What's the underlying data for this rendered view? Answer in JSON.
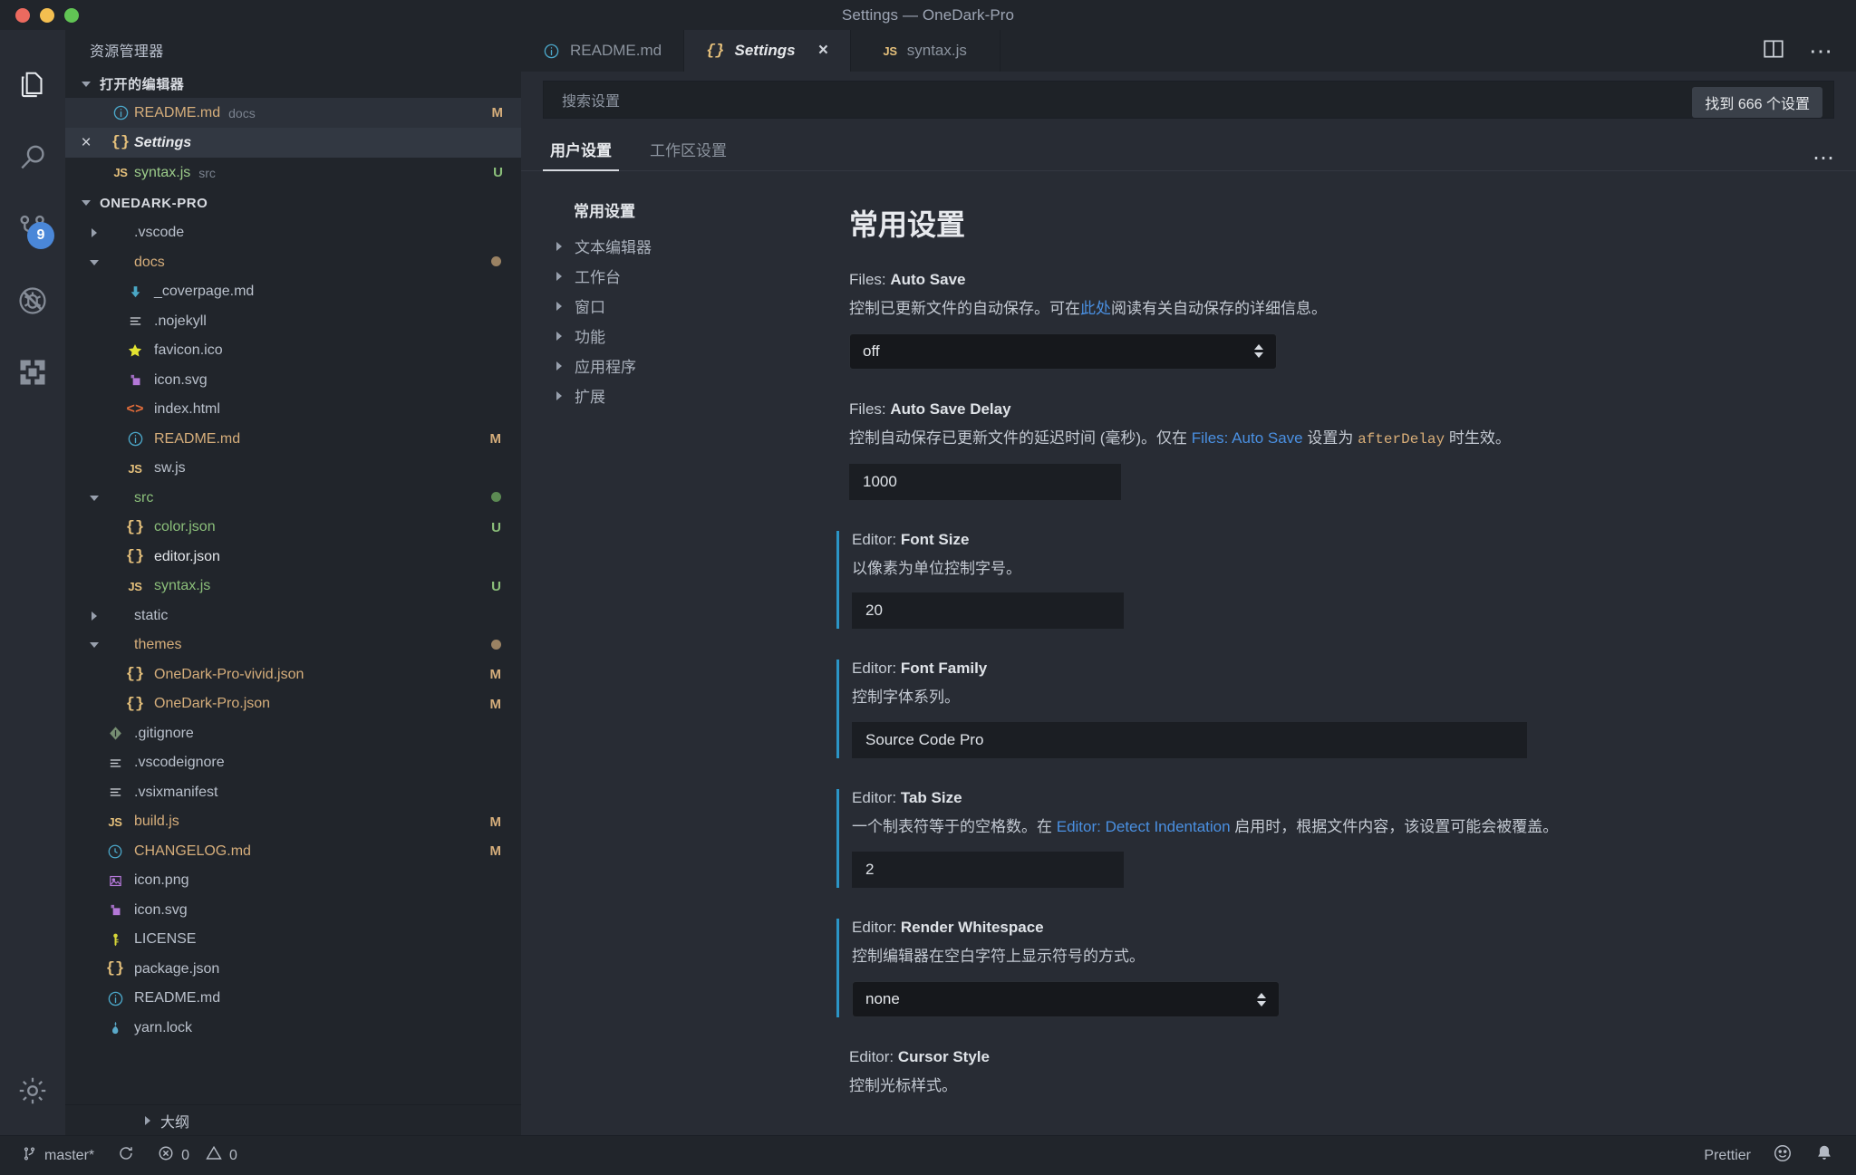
{
  "window": {
    "title": "Settings — OneDark-Pro",
    "traffic_lights": [
      "close",
      "minimize",
      "maximize"
    ]
  },
  "activity_bar": {
    "items": [
      {
        "name": "explorer",
        "icon": "files-icon",
        "badge": null
      },
      {
        "name": "search",
        "icon": "search-icon",
        "badge": null
      },
      {
        "name": "source-control",
        "icon": "source-control-icon",
        "badge": "9"
      },
      {
        "name": "debug",
        "icon": "debug-icon",
        "badge": null
      },
      {
        "name": "extensions",
        "icon": "extensions-icon",
        "badge": null
      }
    ],
    "settings_icon": "gear-icon"
  },
  "sidebar": {
    "title": "资源管理器",
    "open_editors": {
      "header": "打开的编辑器",
      "items": [
        {
          "icon": "info-icon",
          "icon_color": "#4ba7c9",
          "name": "README.md",
          "name_color": "#d6ae7b",
          "sub": "docs",
          "status": "M",
          "status_color": "#d6ae7b",
          "state": "hover"
        },
        {
          "icon": "braces-icon",
          "icon_color": "#e5c07b",
          "name": "Settings",
          "name_color": "#e6e8eb",
          "sub": "",
          "status": "",
          "status_color": "",
          "state": "active",
          "close": "×",
          "italic": true
        },
        {
          "icon": "js-icon",
          "icon_color": "#e5c07b",
          "name": "syntax.js",
          "name_color": "#9ccc8a",
          "sub": "src",
          "status": "U",
          "status_color": "#8bbf7a",
          "state": "normal"
        }
      ]
    },
    "project": {
      "header": "ONEDARK-PRO",
      "rows": [
        {
          "arrow": "closed",
          "indent": 1,
          "icon": "",
          "icon_color": "",
          "name": ".vscode",
          "color": "#b9c0cb",
          "status": "",
          "dot": ""
        },
        {
          "arrow": "open",
          "indent": 1,
          "icon": "",
          "icon_color": "",
          "name": "docs",
          "color": "#d6ae7b",
          "status": "",
          "dot": "#9a8263"
        },
        {
          "arrow": "none",
          "indent": 2,
          "icon": "markdown-down-icon",
          "icon_color": "#4aa8c6",
          "name": "_coverpage.md",
          "color": "#b9c0cb",
          "status": "",
          "dot": ""
        },
        {
          "arrow": "none",
          "indent": 2,
          "icon": "lines-icon",
          "icon_color": "#d7dae0",
          "name": ".nojekyll",
          "color": "#b9c0cb",
          "status": "",
          "dot": ""
        },
        {
          "arrow": "none",
          "indent": 2,
          "icon": "star-icon",
          "icon_color": "#e3e331",
          "name": "favicon.ico",
          "color": "#b9c0cb",
          "status": "",
          "dot": ""
        },
        {
          "arrow": "none",
          "indent": 2,
          "icon": "svg-icon",
          "icon_color": "#b478d8",
          "name": "icon.svg",
          "color": "#b9c0cb",
          "status": "",
          "dot": ""
        },
        {
          "arrow": "none",
          "indent": 2,
          "icon": "html-icon",
          "icon_color": "#e06c3a",
          "name": "index.html",
          "color": "#b9c0cb",
          "status": "",
          "dot": ""
        },
        {
          "arrow": "none",
          "indent": 2,
          "icon": "info-icon",
          "icon_color": "#4ba7c9",
          "name": "README.md",
          "color": "#d6ae7b",
          "status": "M",
          "status_color": "#d6ae7b",
          "dot": ""
        },
        {
          "arrow": "none",
          "indent": 2,
          "icon": "js-icon",
          "icon_color": "#e5c07b",
          "name": "sw.js",
          "color": "#b9c0cb",
          "status": "",
          "dot": ""
        },
        {
          "arrow": "open",
          "indent": 1,
          "icon": "",
          "icon_color": "",
          "name": "src",
          "color": "#8bbf7a",
          "status": "",
          "dot": "#5c8a53"
        },
        {
          "arrow": "none",
          "indent": 2,
          "icon": "braces-icon",
          "icon_color": "#e5c07b",
          "name": "color.json",
          "color": "#8bbf7a",
          "status": "U",
          "status_color": "#8bbf7a",
          "dot": ""
        },
        {
          "arrow": "none",
          "indent": 2,
          "icon": "braces-icon",
          "icon_color": "#e5c07b",
          "name": "editor.json",
          "color": "#e3e6ea",
          "status": "",
          "dot": ""
        },
        {
          "arrow": "none",
          "indent": 2,
          "icon": "js-icon",
          "icon_color": "#e5c07b",
          "name": "syntax.js",
          "color": "#8bbf7a",
          "status": "U",
          "status_color": "#8bbf7a",
          "dot": ""
        },
        {
          "arrow": "closed",
          "indent": 1,
          "icon": "",
          "icon_color": "",
          "name": "static",
          "color": "#b9c0cb",
          "status": "",
          "dot": ""
        },
        {
          "arrow": "open",
          "indent": 1,
          "icon": "",
          "icon_color": "",
          "name": "themes",
          "color": "#d6ae7b",
          "status": "",
          "dot": "#9a8263"
        },
        {
          "arrow": "none",
          "indent": 2,
          "icon": "braces-icon",
          "icon_color": "#e5c07b",
          "name": "OneDark-Pro-vivid.json",
          "color": "#d6ae7b",
          "status": "M",
          "status_color": "#d6ae7b",
          "dot": ""
        },
        {
          "arrow": "none",
          "indent": 2,
          "icon": "braces-icon",
          "icon_color": "#e5c07b",
          "name": "OneDark-Pro.json",
          "color": "#d6ae7b",
          "status": "M",
          "status_color": "#d6ae7b",
          "dot": ""
        },
        {
          "arrow": "none",
          "indent": 1,
          "icon": "git-icon",
          "icon_color": "#7f9a7a",
          "name": ".gitignore",
          "color": "#b9c0cb",
          "status": "",
          "dot": ""
        },
        {
          "arrow": "none",
          "indent": 1,
          "icon": "lines-icon",
          "icon_color": "#d7dae0",
          "name": ".vscodeignore",
          "color": "#b9c0cb",
          "status": "",
          "dot": ""
        },
        {
          "arrow": "none",
          "indent": 1,
          "icon": "lines-icon",
          "icon_color": "#d7dae0",
          "name": ".vsixmanifest",
          "color": "#b9c0cb",
          "status": "",
          "dot": ""
        },
        {
          "arrow": "none",
          "indent": 1,
          "icon": "js-icon",
          "icon_color": "#e5c07b",
          "name": "build.js",
          "color": "#d6ae7b",
          "status": "M",
          "status_color": "#d6ae7b",
          "dot": ""
        },
        {
          "arrow": "none",
          "indent": 1,
          "icon": "clock-icon",
          "icon_color": "#4ba7c9",
          "name": "CHANGELOG.md",
          "color": "#d6ae7b",
          "status": "M",
          "status_color": "#d6ae7b",
          "dot": ""
        },
        {
          "arrow": "none",
          "indent": 1,
          "icon": "image-icon",
          "icon_color": "#b478d8",
          "name": "icon.png",
          "color": "#b9c0cb",
          "status": "",
          "dot": ""
        },
        {
          "arrow": "none",
          "indent": 1,
          "icon": "svg-icon",
          "icon_color": "#b478d8",
          "name": "icon.svg",
          "color": "#b9c0cb",
          "status": "",
          "dot": ""
        },
        {
          "arrow": "none",
          "indent": 1,
          "icon": "key-icon",
          "icon_color": "#d7d738",
          "name": "LICENSE",
          "color": "#b9c0cb",
          "status": "",
          "dot": ""
        },
        {
          "arrow": "none",
          "indent": 1,
          "icon": "braces-icon",
          "icon_color": "#e5c07b",
          "name": "package.json",
          "color": "#b9c0cb",
          "status": "",
          "dot": ""
        },
        {
          "arrow": "none",
          "indent": 1,
          "icon": "info-icon",
          "icon_color": "#4ba7c9",
          "name": "README.md",
          "color": "#b9c0cb",
          "status": "",
          "dot": ""
        },
        {
          "arrow": "none",
          "indent": 1,
          "icon": "yarn-icon",
          "icon_color": "#5aa9c9",
          "name": "yarn.lock",
          "color": "#b9c0cb",
          "status": "",
          "dot": ""
        }
      ]
    },
    "outline": {
      "label": "大纲"
    }
  },
  "tabs": [
    {
      "icon": "info-icon",
      "icon_color": "#4ba7c9",
      "label": "README.md",
      "active": false,
      "closable": false
    },
    {
      "icon": "braces-icon",
      "icon_color": "#e5c07b",
      "label": "Settings",
      "active": true,
      "closable": true,
      "close_label": "×"
    },
    {
      "icon": "js-icon",
      "icon_color": "#e5c07b",
      "label": "syntax.js",
      "active": false,
      "closable": false
    }
  ],
  "tab_actions": [
    {
      "name": "split-editor-icon"
    },
    {
      "name": "more-actions-icon",
      "label": "⋯"
    }
  ],
  "settings": {
    "search_placeholder": "搜索设置",
    "search_value": "",
    "found_label": "找到 666 个设置",
    "tabs": [
      {
        "label": "用户设置",
        "selected": true
      },
      {
        "label": "工作区设置",
        "selected": false
      }
    ],
    "more_label": "⋯",
    "toc": {
      "header": "常用设置",
      "items": [
        {
          "label": "文本编辑器"
        },
        {
          "label": "工作台"
        },
        {
          "label": "窗口"
        },
        {
          "label": "功能"
        },
        {
          "label": "应用程序"
        },
        {
          "label": "扩展"
        }
      ]
    },
    "page_title": "常用设置",
    "accent_modified": "#2b95c6",
    "items": [
      {
        "key_prefix": "Files: ",
        "key_name": "Auto Save",
        "desc_parts": [
          {
            "t": "控制已更新文件的自动保存。可在",
            "k": "plain"
          },
          {
            "t": "此处",
            "k": "link"
          },
          {
            "t": "阅读有关自动保存的详细信息。",
            "k": "plain"
          }
        ],
        "control": "select",
        "value": "off",
        "modified": false,
        "width": "wide-select"
      },
      {
        "key_prefix": "Files: ",
        "key_name": "Auto Save Delay",
        "desc_parts": [
          {
            "t": "控制自动保存已更新文件的延迟时间 (毫秒)。仅在 ",
            "k": "plain"
          },
          {
            "t": "Files: Auto Save",
            "k": "link"
          },
          {
            "t": " 设置为 ",
            "k": "plain"
          },
          {
            "t": "afterDelay",
            "k": "code"
          },
          {
            "t": " 时生效。",
            "k": "plain"
          }
        ],
        "control": "input",
        "value": "1000",
        "modified": false
      },
      {
        "key_prefix": "Editor: ",
        "key_name": "Font Size",
        "desc_parts": [
          {
            "t": "以像素为单位控制字号。",
            "k": "plain"
          }
        ],
        "control": "input",
        "value": "20",
        "modified": true
      },
      {
        "key_prefix": "Editor: ",
        "key_name": "Font Family",
        "desc_parts": [
          {
            "t": "控制字体系列。",
            "k": "plain"
          }
        ],
        "control": "input-wide",
        "value": "Source Code Pro",
        "modified": true
      },
      {
        "key_prefix": "Editor: ",
        "key_name": "Tab Size",
        "desc_parts": [
          {
            "t": "一个制表符等于的空格数。在 ",
            "k": "plain"
          },
          {
            "t": "Editor: Detect Indentation",
            "k": "link"
          },
          {
            "t": " 启用时，根据文件内容，该设置可能会被覆盖。",
            "k": "plain"
          }
        ],
        "control": "input",
        "value": "2",
        "modified": true
      },
      {
        "key_prefix": "Editor: ",
        "key_name": "Render Whitespace",
        "desc_parts": [
          {
            "t": "控制编辑器在空白字符上显示符号的方式。",
            "k": "plain"
          }
        ],
        "control": "select",
        "value": "none",
        "modified": true
      },
      {
        "key_prefix": "Editor: ",
        "key_name": "Cursor Style",
        "desc_parts": [
          {
            "t": "控制光标样式。",
            "k": "plain"
          }
        ],
        "control": "none",
        "value": "",
        "modified": false
      }
    ]
  },
  "statusbar": {
    "branch": "master*",
    "sync_icon": "sync-icon",
    "errors": "0",
    "warnings": "0",
    "right": [
      {
        "label": "Prettier",
        "icon": ""
      },
      {
        "label": "",
        "icon": "smiley-icon"
      },
      {
        "label": "",
        "icon": "bell-icon"
      }
    ]
  }
}
